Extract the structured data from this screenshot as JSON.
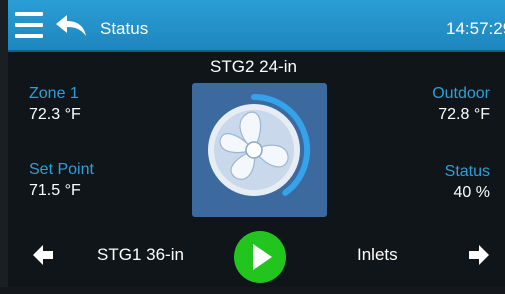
{
  "header": {
    "title": "Status",
    "time": "14:57:29"
  },
  "fan": {
    "name": "STG2 24-in",
    "level_percent": 40
  },
  "zone": {
    "label": "Zone 1",
    "value": "72.3 °F"
  },
  "setpoint": {
    "label": "Set Point",
    "value": "71.5 °F"
  },
  "outdoor": {
    "label": "Outdoor",
    "value": "72.8 °F"
  },
  "status": {
    "label": "Status",
    "value": "40 %"
  },
  "nav": {
    "prev_label": "STG1 36-in",
    "next_label": "Inlets"
  },
  "colors": {
    "accent_blue": "#2e9fd8",
    "header_bg": "#1e86bd",
    "play_green": "#22c41e",
    "fan_tile": "#3c6a9f"
  },
  "icons": [
    "menu-icon",
    "back-arrow-icon",
    "fan-icon",
    "play-icon",
    "arrow-left-icon",
    "arrow-right-icon"
  ]
}
